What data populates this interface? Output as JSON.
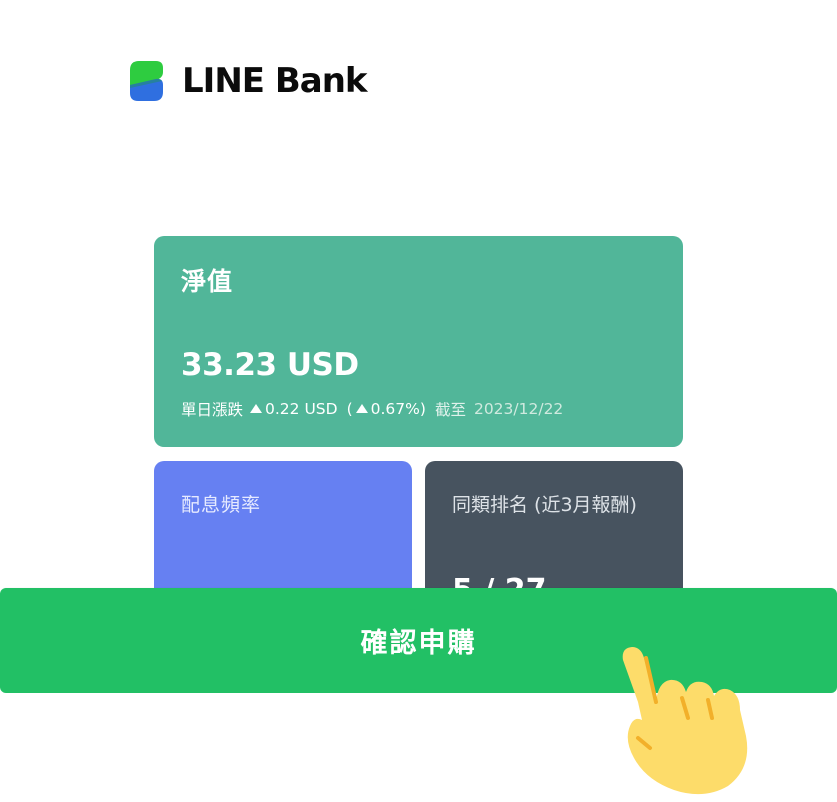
{
  "brand": {
    "name": "LINE Bank",
    "logo_icon": "line-bank-logo-icon",
    "colors": {
      "logo_top": "#2ecc40",
      "logo_bottom": "#2f6fe0",
      "text": "#0b0b0b"
    }
  },
  "nav_card": {
    "title": "淨值",
    "value": "33.23 USD",
    "change_label": "單日漲跌",
    "change_icon": "triangle-up-icon",
    "change_amount": "0.22 USD",
    "change_paren_open": "(",
    "change_percent": "0.67%)",
    "as_of_label": "截至",
    "as_of_date": "2023/12/22",
    "color": "#51b699"
  },
  "dividend_card": {
    "label": "配息頻率",
    "color": "#6680f2"
  },
  "rank_card": {
    "label": "同類排名 (近3月報酬)",
    "value": "5 / 27",
    "color": "#47535f"
  },
  "confirm_button": {
    "label": "確認申購",
    "color": "#22c065"
  },
  "pointer": {
    "icon": "pointing-hand-icon",
    "color": "#fddc6a"
  }
}
